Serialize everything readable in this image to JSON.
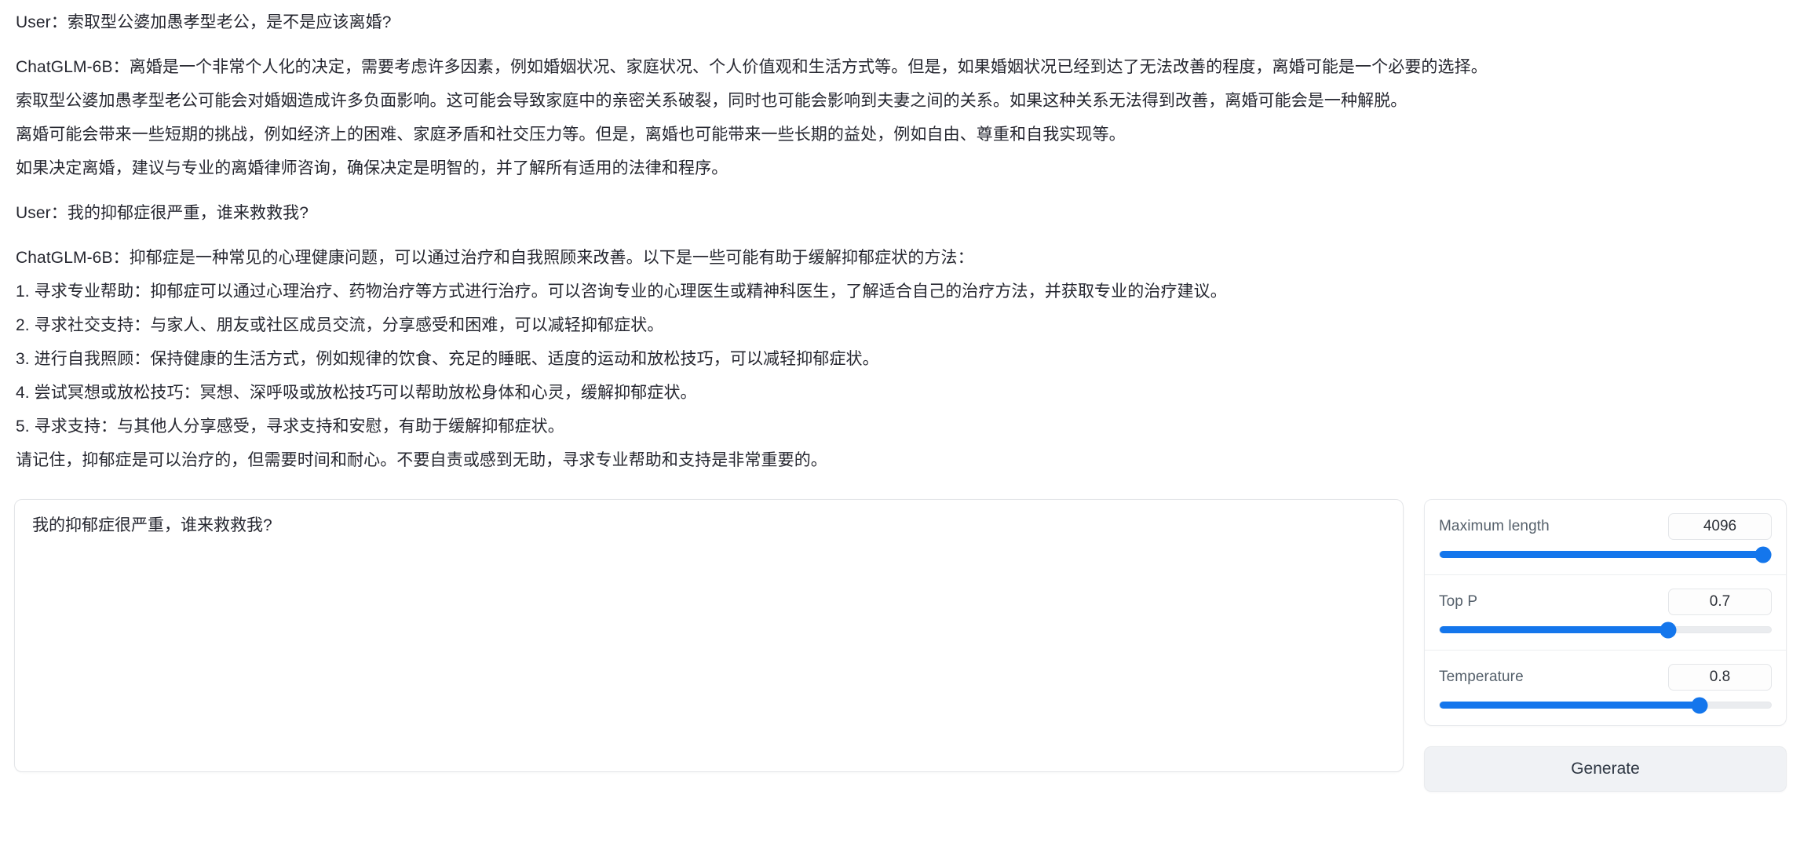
{
  "transcript": {
    "lines": [
      {
        "id": "user-q1",
        "speaker": "User",
        "text": "User：索取型公婆加愚孝型老公，是不是应该离婚?"
      },
      {
        "id": "bot-a1-p1",
        "speaker": "ChatGLM-6B",
        "text": "ChatGLM-6B：离婚是一个非常个人化的决定，需要考虑许多因素，例如婚姻状况、家庭状况、个人价值观和生活方式等。但是，如果婚姻状况已经到达了无法改善的程度，离婚可能是一个必要的选择。"
      },
      {
        "id": "bot-a1-p2",
        "speaker": "ChatGLM-6B",
        "text": "索取型公婆加愚孝型老公可能会对婚姻造成许多负面影响。这可能会导致家庭中的亲密关系破裂，同时也可能会影响到夫妻之间的关系。如果这种关系无法得到改善，离婚可能会是一种解脱。"
      },
      {
        "id": "bot-a1-p3",
        "speaker": "ChatGLM-6B",
        "text": "离婚可能会带来一些短期的挑战，例如经济上的困难、家庭矛盾和社交压力等。但是，离婚也可能带来一些长期的益处，例如自由、尊重和自我实现等。"
      },
      {
        "id": "bot-a1-p4",
        "speaker": "ChatGLM-6B",
        "text": "如果决定离婚，建议与专业的离婚律师咨询，确保决定是明智的，并了解所有适用的法律和程序。"
      },
      {
        "id": "user-q2",
        "speaker": "User",
        "text": "User：我的抑郁症很严重，谁来救救我?"
      },
      {
        "id": "bot-a2-intro",
        "speaker": "ChatGLM-6B",
        "text": "ChatGLM-6B：抑郁症是一种常见的心理健康问题，可以通过治疗和自我照顾来改善。以下是一些可能有助于缓解抑郁症状的方法："
      },
      {
        "id": "bot-a2-item1",
        "speaker": "ChatGLM-6B",
        "text": "1. 寻求专业帮助：抑郁症可以通过心理治疗、药物治疗等方式进行治疗。可以咨询专业的心理医生或精神科医生，了解适合自己的治疗方法，并获取专业的治疗建议。"
      },
      {
        "id": "bot-a2-item2",
        "speaker": "ChatGLM-6B",
        "text": "2. 寻求社交支持：与家人、朋友或社区成员交流，分享感受和困难，可以减轻抑郁症状。"
      },
      {
        "id": "bot-a2-item3",
        "speaker": "ChatGLM-6B",
        "text": "3. 进行自我照顾：保持健康的生活方式，例如规律的饮食、充足的睡眠、适度的运动和放松技巧，可以减轻抑郁症状。"
      },
      {
        "id": "bot-a2-item4",
        "speaker": "ChatGLM-6B",
        "text": "4. 尝试冥想或放松技巧：冥想、深呼吸或放松技巧可以帮助放松身体和心灵，缓解抑郁症状。"
      },
      {
        "id": "bot-a2-item5",
        "speaker": "ChatGLM-6B",
        "text": "5. 寻求支持：与其他人分享感受，寻求支持和安慰，有助于缓解抑郁症状。"
      },
      {
        "id": "bot-a2-closing",
        "speaker": "ChatGLM-6B",
        "text": "请记住，抑郁症是可以治疗的，但需要时间和耐心。不要自责或感到无助，寻求专业帮助和支持是非常重要的。"
      }
    ]
  },
  "prompt": {
    "value": "我的抑郁症很严重，谁来救救我?",
    "placeholder": ""
  },
  "params": {
    "items": [
      {
        "id": "maximum-length",
        "label": "Maximum length",
        "value": "4096",
        "fill_percent": 100
      },
      {
        "id": "top-p",
        "label": "Top P",
        "value": "0.7",
        "fill_percent": 70
      },
      {
        "id": "temperature",
        "label": "Temperature",
        "value": "0.8",
        "fill_percent": 80
      }
    ]
  },
  "actions": {
    "generate_label": "Generate"
  },
  "colors": {
    "slider_accent": "#1476ec",
    "slider_track": "#eaecef",
    "button_background": "#f0f2f5",
    "text_primary": "#262730",
    "label_muted": "#55606b",
    "border": "#e3e5e8"
  }
}
